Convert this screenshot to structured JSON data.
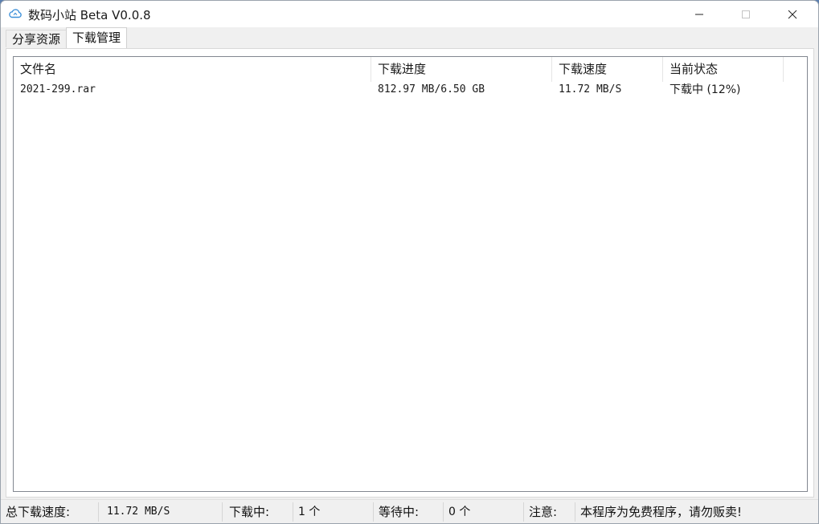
{
  "window": {
    "title": "数码小站 Beta V0.0.8",
    "icon": "cloud-icon"
  },
  "tabs": [
    {
      "label": "分享资源",
      "active": false
    },
    {
      "label": "下载管理",
      "active": true
    }
  ],
  "table": {
    "columns": [
      "文件名",
      "下载进度",
      "下载速度",
      "当前状态"
    ],
    "rows": [
      {
        "filename": "2021-299.rar",
        "progress": "812.97 MB/6.50 GB",
        "speed": "11.72 MB/S",
        "status": "下载中 (12%)"
      }
    ]
  },
  "status": {
    "total_speed_label": "总下载速度:",
    "total_speed_value": "11.72 MB/S",
    "downloading_label": "下载中:",
    "downloading_value": "1 个",
    "waiting_label": "等待中:",
    "waiting_value": "0 个",
    "notice_label": "注意:",
    "notice_text": "本程序为免费程序，请勿贩卖!"
  }
}
